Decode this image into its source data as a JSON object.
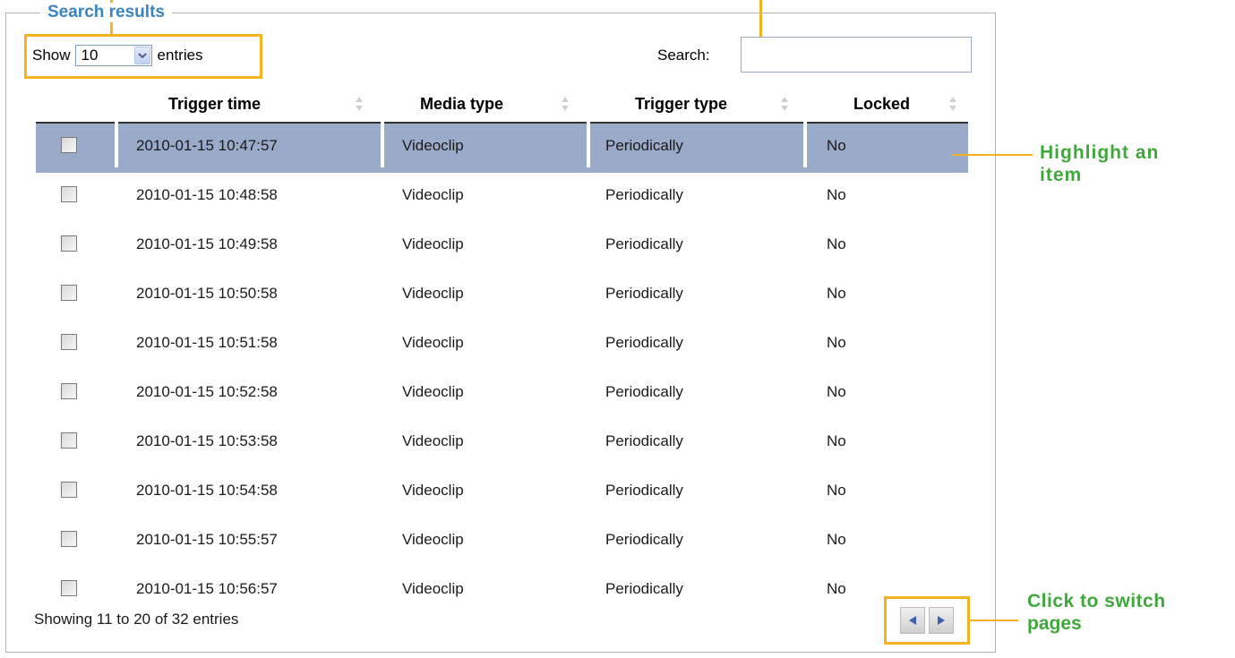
{
  "panel": {
    "title": "Search results"
  },
  "length": {
    "show_label": "Show",
    "value": "10",
    "entries_label": "entries"
  },
  "search": {
    "label": "Search:",
    "value": ""
  },
  "columns": [
    "Trigger time",
    "Media type",
    "Trigger type",
    "Locked"
  ],
  "rows": [
    {
      "time": "2010-01-15 10:47:57",
      "media": "Videoclip",
      "trigger": "Periodically",
      "locked": "No"
    },
    {
      "time": "2010-01-15 10:48:58",
      "media": "Videoclip",
      "trigger": "Periodically",
      "locked": "No"
    },
    {
      "time": "2010-01-15 10:49:58",
      "media": "Videoclip",
      "trigger": "Periodically",
      "locked": "No"
    },
    {
      "time": "2010-01-15 10:50:58",
      "media": "Videoclip",
      "trigger": "Periodically",
      "locked": "No"
    },
    {
      "time": "2010-01-15 10:51:58",
      "media": "Videoclip",
      "trigger": "Periodically",
      "locked": "No"
    },
    {
      "time": "2010-01-15 10:52:58",
      "media": "Videoclip",
      "trigger": "Periodically",
      "locked": "No"
    },
    {
      "time": "2010-01-15 10:53:58",
      "media": "Videoclip",
      "trigger": "Periodically",
      "locked": "No"
    },
    {
      "time": "2010-01-15 10:54:58",
      "media": "Videoclip",
      "trigger": "Periodically",
      "locked": "No"
    },
    {
      "time": "2010-01-15 10:55:57",
      "media": "Videoclip",
      "trigger": "Periodically",
      "locked": "No"
    },
    {
      "time": "2010-01-15 10:56:57",
      "media": "Videoclip",
      "trigger": "Periodically",
      "locked": "No"
    }
  ],
  "highlighted_row": 0,
  "info": "Showing 11 to 20 of 32 entries",
  "annotations": {
    "highlight_line1": "Highlight an",
    "highlight_line2": "item",
    "switch_line1": "Click to switch",
    "switch_line2": "pages"
  },
  "colors": {
    "callout": "#f5b320",
    "highlight_row": "#9aaac9",
    "note_text": "#3ea83a",
    "legend_text": "#3a84c4"
  }
}
